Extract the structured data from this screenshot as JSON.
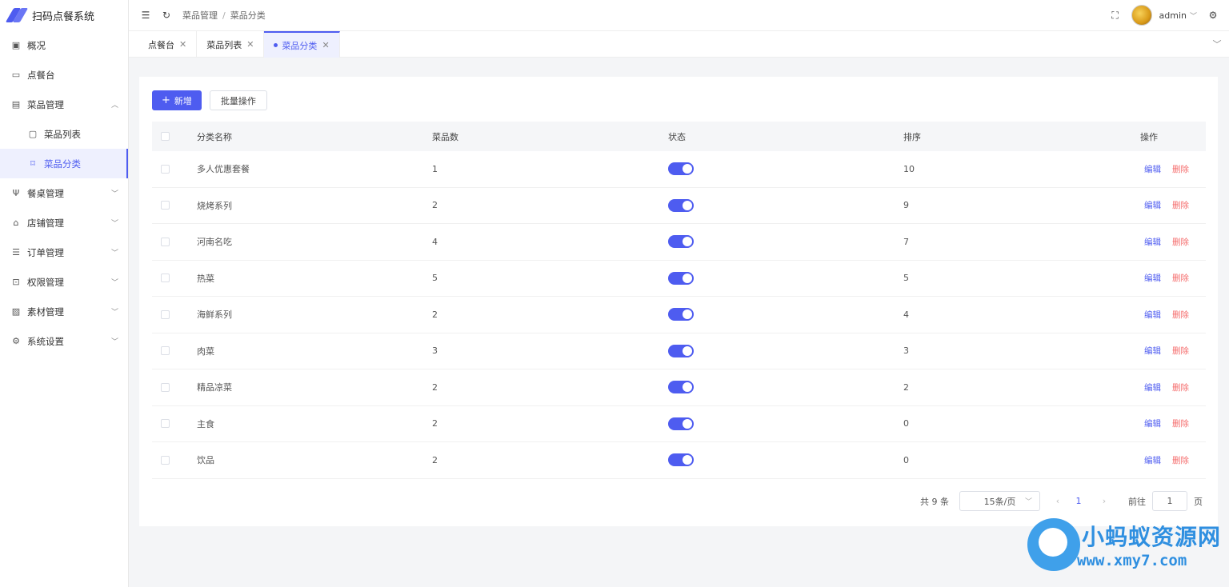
{
  "app": {
    "title": "扫码点餐系统"
  },
  "sidebar": {
    "items": [
      {
        "label": "概况",
        "icon": "dashboard-icon"
      },
      {
        "label": "点餐台",
        "icon": "monitor-icon"
      },
      {
        "label": "菜品管理",
        "icon": "dish-icon",
        "expanded": true
      },
      {
        "label": "菜品列表",
        "icon": "message-icon",
        "sub": true
      },
      {
        "label": "菜品分类",
        "icon": "bookmark-icon",
        "sub": true,
        "active": true
      },
      {
        "label": "餐桌管理",
        "icon": "fork-icon"
      },
      {
        "label": "店铺管理",
        "icon": "shop-icon"
      },
      {
        "label": "订单管理",
        "icon": "order-icon"
      },
      {
        "label": "权限管理",
        "icon": "lock-icon"
      },
      {
        "label": "素材管理",
        "icon": "image-icon"
      },
      {
        "label": "系统设置",
        "icon": "gear-icon"
      }
    ]
  },
  "header": {
    "breadcrumb": [
      "菜品管理",
      "菜品分类"
    ],
    "breadcrumb_sep": "/",
    "username": "admin"
  },
  "tabs": [
    {
      "label": "点餐台"
    },
    {
      "label": "菜品列表"
    },
    {
      "label": "菜品分类",
      "active": true
    }
  ],
  "toolbar": {
    "add_label": "新增",
    "batch_label": "批量操作"
  },
  "table": {
    "columns": [
      "分类名称",
      "菜品数",
      "状态",
      "排序",
      "操作"
    ],
    "edit_label": "编辑",
    "delete_label": "删除",
    "rows": [
      {
        "name": "多人优惠套餐",
        "count": "1",
        "enabled": true,
        "sort": "10"
      },
      {
        "name": "烧烤系列",
        "count": "2",
        "enabled": true,
        "sort": "9"
      },
      {
        "name": "河南名吃",
        "count": "4",
        "enabled": true,
        "sort": "7"
      },
      {
        "name": "热菜",
        "count": "5",
        "enabled": true,
        "sort": "5"
      },
      {
        "name": "海鲜系列",
        "count": "2",
        "enabled": true,
        "sort": "4"
      },
      {
        "name": "肉菜",
        "count": "3",
        "enabled": true,
        "sort": "3"
      },
      {
        "name": "精品凉菜",
        "count": "2",
        "enabled": true,
        "sort": "2"
      },
      {
        "name": "主食",
        "count": "2",
        "enabled": true,
        "sort": "0"
      },
      {
        "name": "饮品",
        "count": "2",
        "enabled": true,
        "sort": "0"
      }
    ]
  },
  "pagination": {
    "total_text": "共 9 条",
    "page_size": "15条/页",
    "current_page": "1",
    "goto_label": "前往",
    "goto_value": "1",
    "page_unit": "页"
  },
  "watermark": {
    "title": "小蚂蚁资源网",
    "url": "www.xmy7.com"
  },
  "colors": {
    "accent": "#4e5cf0",
    "danger": "#f56c6c",
    "watermark": "#2f8fe0"
  }
}
